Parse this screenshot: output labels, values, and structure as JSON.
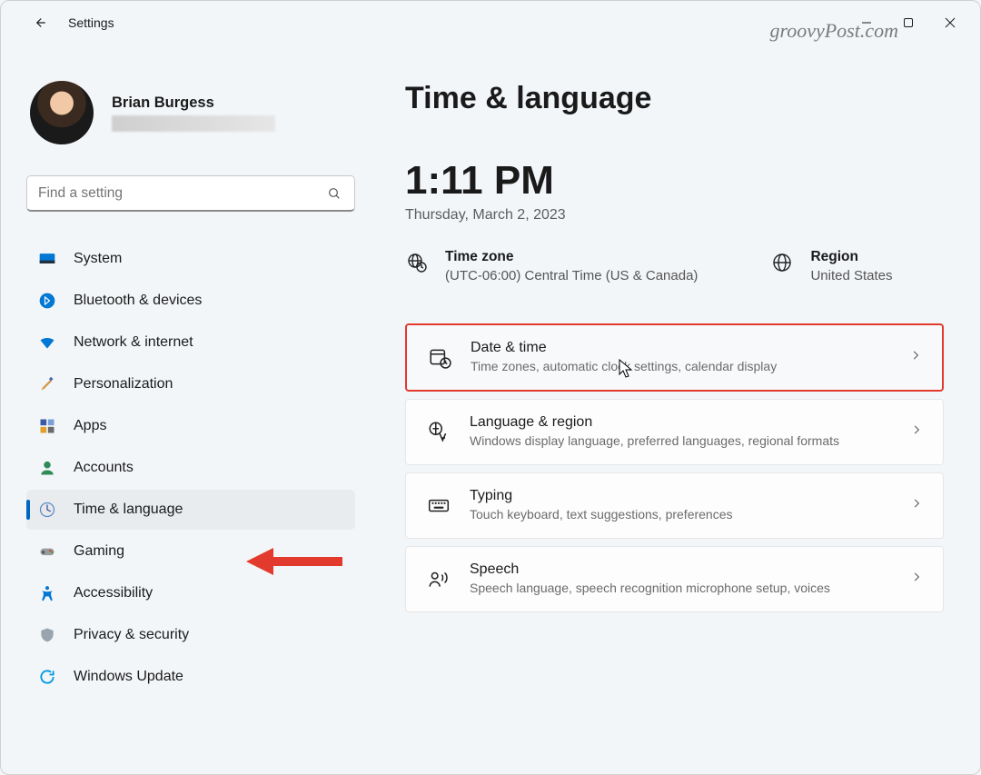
{
  "titlebar": {
    "app_title": "Settings"
  },
  "watermark": "groovyPost.com",
  "profile": {
    "name": "Brian Burgess"
  },
  "search": {
    "placeholder": "Find a setting"
  },
  "nav": [
    {
      "key": "system",
      "label": "System"
    },
    {
      "key": "bluetooth",
      "label": "Bluetooth & devices"
    },
    {
      "key": "network",
      "label": "Network & internet"
    },
    {
      "key": "personalization",
      "label": "Personalization"
    },
    {
      "key": "apps",
      "label": "Apps"
    },
    {
      "key": "accounts",
      "label": "Accounts"
    },
    {
      "key": "time",
      "label": "Time & language"
    },
    {
      "key": "gaming",
      "label": "Gaming"
    },
    {
      "key": "accessibility",
      "label": "Accessibility"
    },
    {
      "key": "privacy",
      "label": "Privacy & security"
    },
    {
      "key": "update",
      "label": "Windows Update"
    }
  ],
  "page": {
    "title": "Time & language",
    "current_time": "1:11 PM",
    "current_date": "Thursday, March 2, 2023",
    "timezone_label": "Time zone",
    "timezone_value": "(UTC-06:00) Central Time (US & Canada)",
    "region_label": "Region",
    "region_value": "United States"
  },
  "settings": [
    {
      "key": "datetime",
      "title": "Date & time",
      "desc": "Time zones, automatic clock settings, calendar display"
    },
    {
      "key": "language",
      "title": "Language & region",
      "desc": "Windows display language, preferred languages, regional formats"
    },
    {
      "key": "typing",
      "title": "Typing",
      "desc": "Touch keyboard, text suggestions, preferences"
    },
    {
      "key": "speech",
      "title": "Speech",
      "desc": "Speech language, speech recognition microphone setup, voices"
    }
  ]
}
